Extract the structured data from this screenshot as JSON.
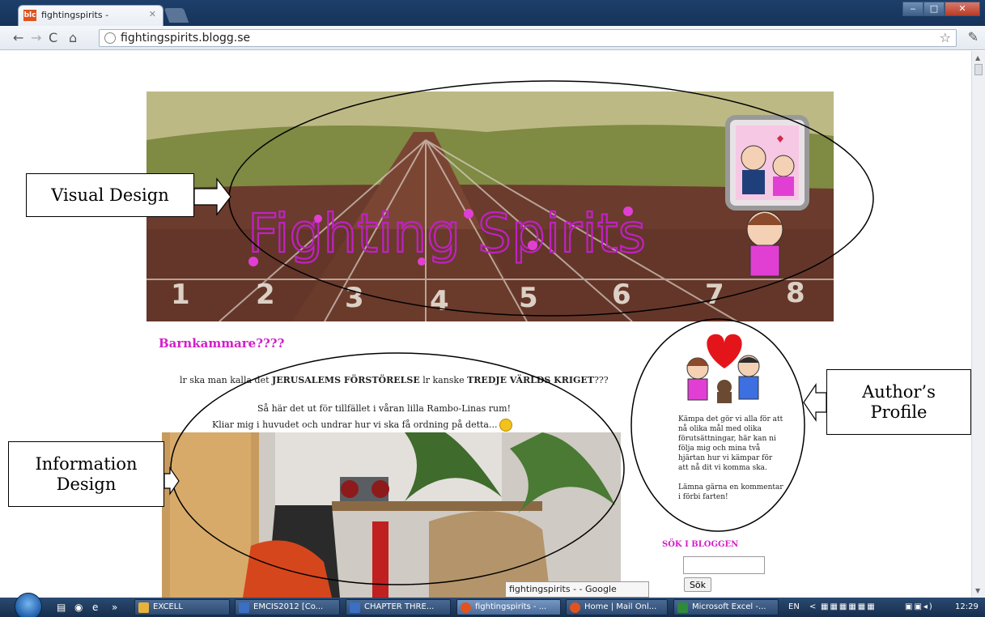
{
  "browser": {
    "tab_title": "fightingspirits -",
    "tab_favicon_text": "blc",
    "url": "fightingspirits.blogg.se"
  },
  "blog": {
    "banner_title": "Fighting Spirits",
    "track_numbers": [
      "1",
      "2",
      "3",
      "4",
      "5",
      "6",
      "7",
      "8"
    ]
  },
  "post": {
    "title": "Barnkammare????",
    "line1_a": "lr ska man kalla det ",
    "line1_b": "JERUSALEMS FÖRSTÖRELSE",
    "line1_c": " lr kanske ",
    "line1_d": "TREDJE VÄRLDS KRIGET",
    "line1_e": "???",
    "line2": "Så här det ut för tillfället i våran lilla Rambo-Linas rum!",
    "line3": "Kliar mig i huvudet och undrar hur vi ska få ordning på detta..."
  },
  "sidebar": {
    "profile_text": "Kämpa det gör vi alla för att nå olika mål med olika förutsättningar, här kan ni följa mig och mina två hjärtan hur vi kämpar för att nå dit vi komma ska.",
    "profile_text2": "Lämna gärna en kommentar i förbi farten!",
    "search_heading": "SÖK I BLOGGEN",
    "search_value": "",
    "search_button": "Sök"
  },
  "annotations": {
    "visual_design": "Visual Design",
    "information_design": "Information Design",
    "authors_profile": "Author’s Profile"
  },
  "tooltip": "fightingspirits - - Google Chrome",
  "taskbar": {
    "items": [
      {
        "label": "EXCELL",
        "color": "#e8b23a"
      },
      {
        "label": "EMCIS2012 [Co...",
        "color": "#3a6fc4"
      },
      {
        "label": "CHAPTER THRE...",
        "color": "#3a6fc4"
      },
      {
        "label": "fightingspirits - ...",
        "color": "#e0531f"
      },
      {
        "label": "Home | Mail Onl...",
        "color": "#e0531f"
      },
      {
        "label": "Microsoft Excel -...",
        "color": "#2f8a3c"
      }
    ],
    "lang": "EN",
    "time": "12:29"
  }
}
